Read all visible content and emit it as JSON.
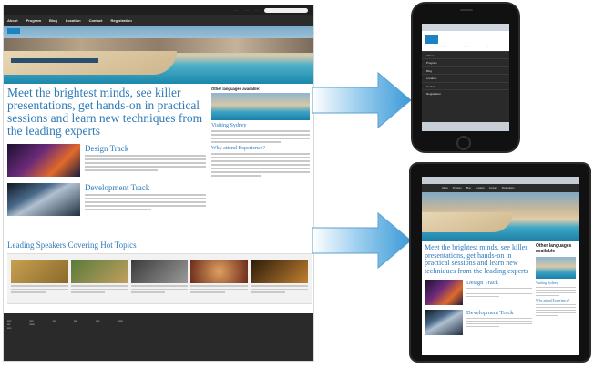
{
  "desktop": {
    "nav": [
      "About",
      "Program",
      "Blog",
      "Location",
      "Contact",
      "Registration"
    ],
    "headline": "Meet the brightest minds, see killer presentations, get hands-on in practical sessions and learn new techniques from the leading experts",
    "track1": "Design Track",
    "track2": "Development Track",
    "right_heading": "Other languages available:",
    "right_sub1": "Visiting Sydney",
    "right_sub2": "Why attend Experience?",
    "speakers_heading": "Leading Speakers Covering Hot Topics"
  },
  "tablet": {
    "headline": "Meet the brightest minds, see killer presentations, get hands-on in practical sessions and learn new techniques from the leading experts",
    "track1": "Design Track",
    "track2": "Development Track",
    "right_heading": "Other languages available",
    "right_sub1": "Visiting Sydney",
    "right_sub2": "Why attend Experience?"
  },
  "colors": {
    "accent": "#2d7ab8",
    "brand": "#1b82c4",
    "nav": "#2b2b2b"
  }
}
